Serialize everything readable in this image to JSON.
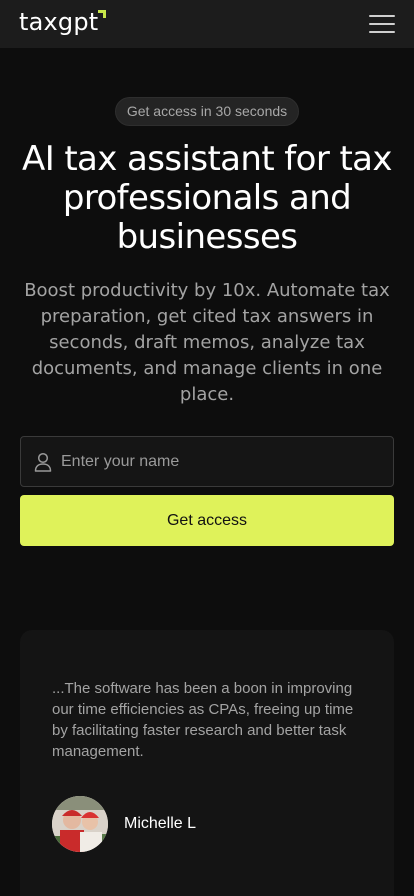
{
  "header": {
    "logo_text": "taxgpt",
    "logo_accent_color": "#c8e64a",
    "menu_icon": "hamburger-menu-icon"
  },
  "hero": {
    "badge": "Get access in 30 seconds",
    "title": "AI tax assistant for tax professionals and businesses",
    "subtitle": "Boost productivity by 10x. Automate tax preparation, get cited tax answers in seconds, draft memos, analyze tax documents, and manage clients in one place."
  },
  "signup": {
    "name_placeholder": "Enter your name",
    "name_value": "",
    "name_icon": "user-icon",
    "cta_label": "Get access",
    "cta_color": "#dff25a"
  },
  "testimonial": {
    "quote": "...The software has been a boon in improving our time efficiencies as CPAs, freeing up time by facilitating faster research and better task management.",
    "author": "Michelle L",
    "avatar_icon": "avatar-photo"
  }
}
